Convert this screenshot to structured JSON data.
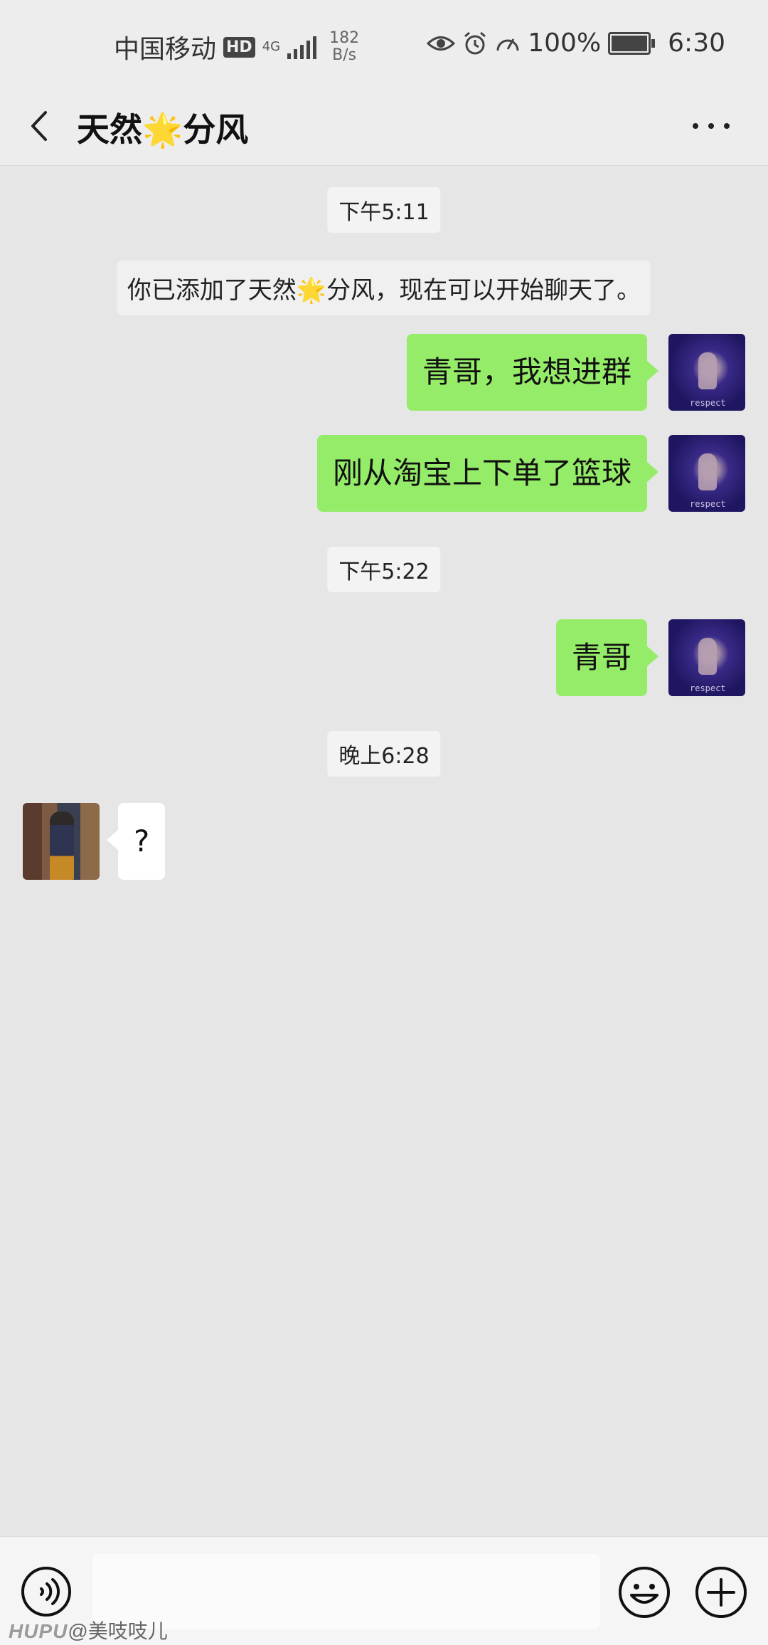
{
  "status_bar": {
    "carrier": "中国移动",
    "hd_badge": "HD",
    "network": "4G",
    "speed_value": "182",
    "speed_unit": "B/s",
    "battery": "100%",
    "time": "6:30"
  },
  "header": {
    "title": "天然🌟分风"
  },
  "messages": [
    {
      "type": "time",
      "text": "下午5:11"
    },
    {
      "type": "system",
      "text": "你已添加了天然🌟分风，现在可以开始聊天了。"
    },
    {
      "type": "sent",
      "text": "青哥，我想进群",
      "avatar_caption": "respect"
    },
    {
      "type": "sent",
      "text": "刚从淘宝上下单了篮球",
      "avatar_caption": "respect"
    },
    {
      "type": "time",
      "text": "下午5:22"
    },
    {
      "type": "sent",
      "text": "青哥",
      "avatar_caption": "respect"
    },
    {
      "type": "time",
      "text": "晚上6:28"
    },
    {
      "type": "received",
      "text": "?"
    }
  ],
  "input_bar": {
    "value": ""
  },
  "watermark": {
    "brand": "HUPU",
    "handle": "@美吱吱儿"
  },
  "colors": {
    "sent_bubble": "#95ec69",
    "received_bubble": "#ffffff",
    "background": "#e6e6e6"
  }
}
